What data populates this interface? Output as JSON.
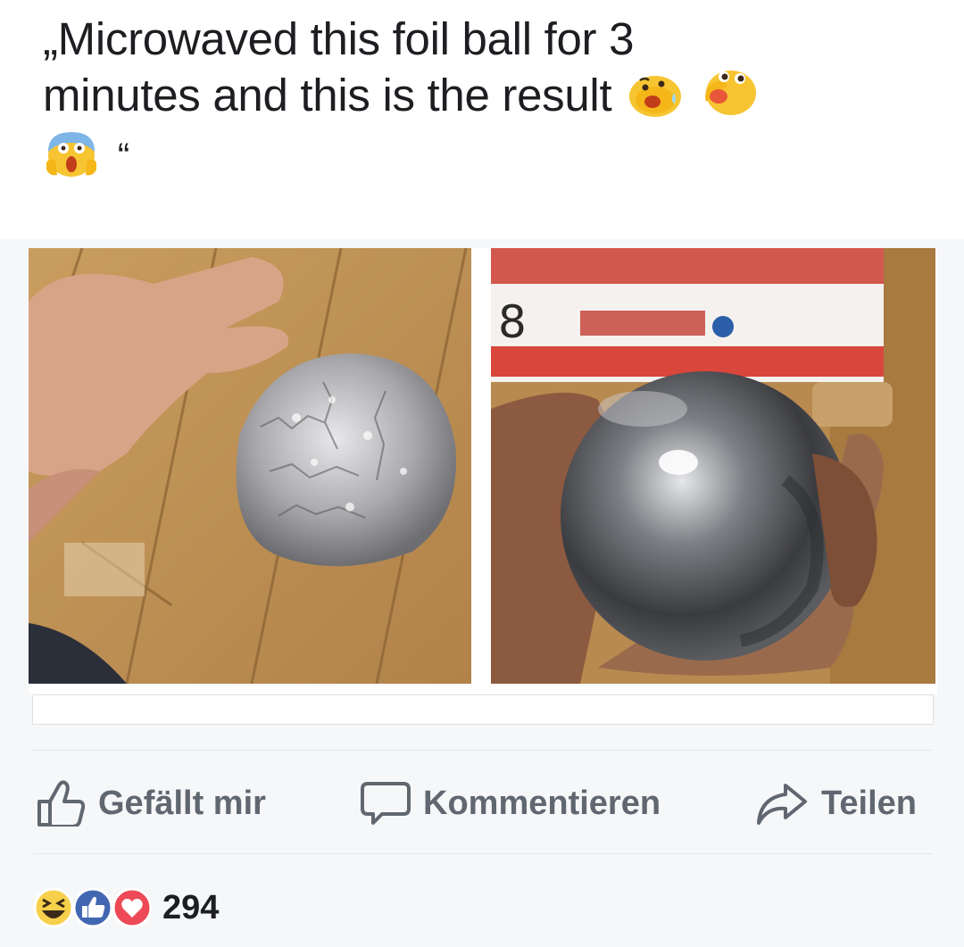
{
  "post": {
    "caption_line1": "„Microwaved this foil ball for 3",
    "caption_line2": "minutes and this is the result",
    "caption_line3_end": "“",
    "caption_emojis": [
      "worried-face-icon",
      "confused-face-icon",
      "screaming-face-icon"
    ]
  },
  "photos": [
    {
      "name": "crumpled foil ball on wooden floor next to hand"
    },
    {
      "name": "shiny polished metal sphere held in hand"
    }
  ],
  "actions": {
    "like_label": "Gefällt mir",
    "comment_label": "Kommentieren",
    "share_label": "Teilen"
  },
  "reactions": {
    "icons": [
      "haha-icon",
      "like-icon",
      "love-icon"
    ],
    "count": "294"
  },
  "colors": {
    "text": "#1c1e21",
    "action_text": "#606770",
    "like_blue": "#4267b2",
    "love_red": "#ed4956",
    "haha_yellow": "#f7d14b"
  }
}
